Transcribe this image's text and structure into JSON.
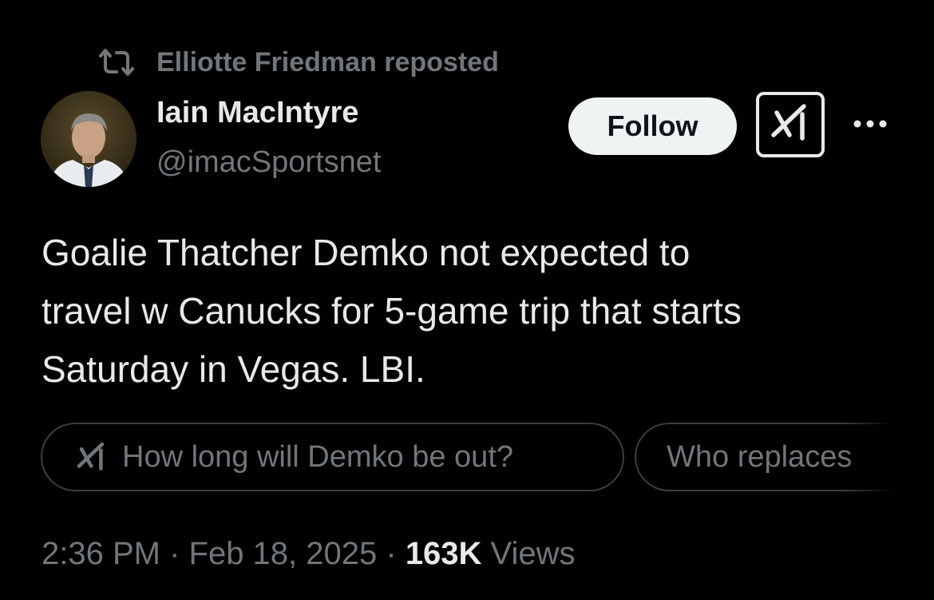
{
  "repost": {
    "text": "Elliotte Friedman reposted",
    "icon": "repost-icon"
  },
  "author": {
    "name": "Iain MacIntyre",
    "handle": "@imacSportsnet"
  },
  "actions": {
    "follow_label": "Follow",
    "grok_icon": "grok-icon",
    "more_icon": "more-icon"
  },
  "tweet": {
    "lines": [
      "Goalie Thatcher Demko not expected to",
      "travel w Canucks for 5-game trip that starts",
      "Saturday in Vegas. LBI."
    ]
  },
  "suggestions": [
    {
      "label": "How long will Demko be out?"
    },
    {
      "label": "Who replaces"
    }
  ],
  "meta": {
    "time": "2:36 PM",
    "sep1": " · ",
    "date": "Feb 18, 2025",
    "sep2": " · ",
    "views_count": "163K",
    "views_label": " Views"
  },
  "colors": {
    "background": "#000000",
    "text_primary": "#e7e9ea",
    "text_secondary": "#71767b",
    "follow_bg": "#eff3f4",
    "chip_border": "#3a3e42"
  }
}
